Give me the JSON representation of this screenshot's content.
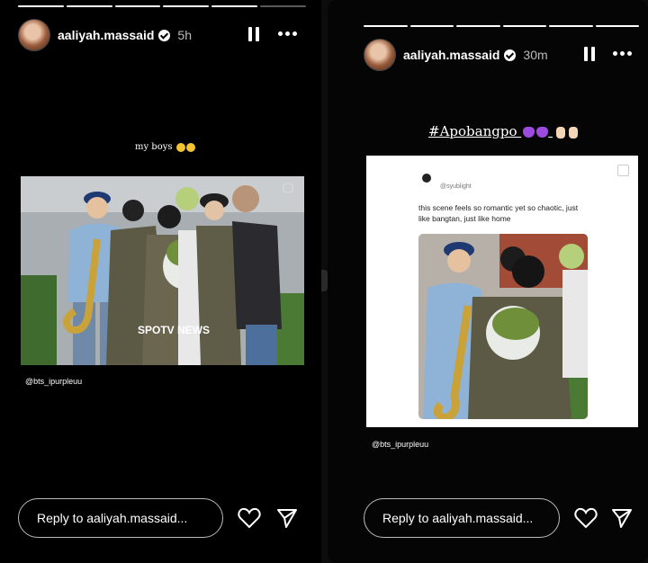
{
  "left_story": {
    "username": "aaliyah.massaid",
    "time": "5h",
    "caption": "my boys",
    "photo_watermark": "SPOTV NEWS",
    "credit": "@bts_ipurpleuu",
    "reply_placeholder": "Reply to aaliyah.massaid...",
    "progress": {
      "total": 6,
      "completed": 5
    }
  },
  "right_story": {
    "username": "aaliyah.massaid",
    "time": "30m",
    "hashtag": "#Apobangpo",
    "tweet": {
      "handle": "@syublight",
      "text": "this scene feels so romantic yet so chaotic, just like bangtan, just like home"
    },
    "credit": "@bts_ipurpleuu",
    "reply_placeholder": "Reply to aaliyah.massaid...",
    "progress": {
      "total": 6,
      "completed": 6
    }
  },
  "icons": {
    "pause": "pause-icon",
    "more": "more-icon",
    "like": "heart-icon",
    "share": "send-icon",
    "verified": "verified-badge-icon"
  },
  "colors": {
    "background": "#000000",
    "heart_emoji": "#9b4be0",
    "text": "#ffffff"
  }
}
